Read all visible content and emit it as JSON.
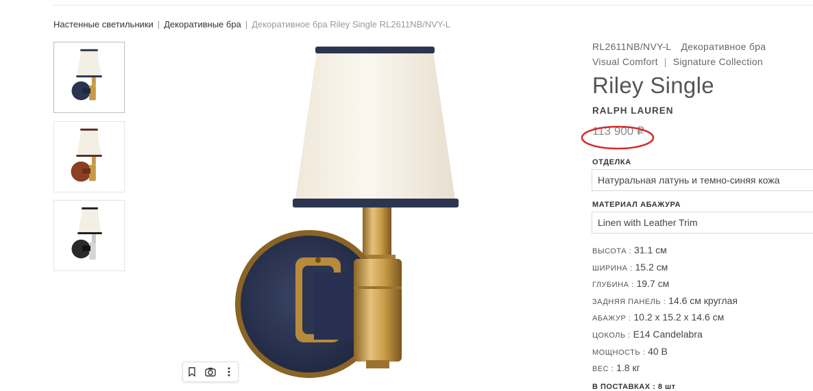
{
  "breadcrumb": {
    "items": [
      "Настенные светильники",
      "Декоративные бра"
    ],
    "separator": "|",
    "current": "Декоративное бра Riley Single RL2611NB/NVY-L"
  },
  "thumbnails": [
    {
      "finish": "navy leather / brass",
      "active": true
    },
    {
      "finish": "saddle leather / brass",
      "active": false
    },
    {
      "finish": "black / nickel",
      "active": false
    }
  ],
  "product": {
    "sku": "RL2611NB/NVY-L",
    "category": "Декоративное бра",
    "manufacturer": "Visual Comfort",
    "collection_separator": "|",
    "collection": "Signature Collection",
    "name": "Riley Single",
    "brand": "RALPH LAUREN",
    "price": "113 900 ₽"
  },
  "options": {
    "finish_label": "ОТДЕЛКА",
    "finish_value": "Натуральная латунь и темно-синяя кожа",
    "shade_label": "МАТЕРИАЛ АБАЖУРА",
    "shade_value": "Linen with Leather Trim"
  },
  "specs": [
    {
      "key": "ВЫСОТА :",
      "value": "31.1 см"
    },
    {
      "key": "ШИРИНА :",
      "value": "15.2 см"
    },
    {
      "key": "ГЛУБИНА :",
      "value": "19.7 см"
    },
    {
      "key": "ЗАДНЯЯ ПАНЕЛЬ :",
      "value": "14.6 см круглая"
    },
    {
      "key": "АБАЖУР :",
      "value": "10.2 x 15.2 x 14.6 см"
    },
    {
      "key": "ЦОКОЛЬ :",
      "value": "E14 Candelabra"
    },
    {
      "key": "МОЩНОСТЬ :",
      "value": "40 В"
    },
    {
      "key": "ВЕС :",
      "value": "1.8 кг"
    }
  ],
  "cutoff_text": "В ПОСТАВКАХ : 8 шт",
  "colors": {
    "annotation_circle": "#d42a2a",
    "navy": "#2b3550",
    "brass": "#c79a45",
    "shade": "#f4efe4"
  },
  "icons": [
    "bookmark-icon",
    "camera-icon",
    "more-vertical-icon"
  ]
}
